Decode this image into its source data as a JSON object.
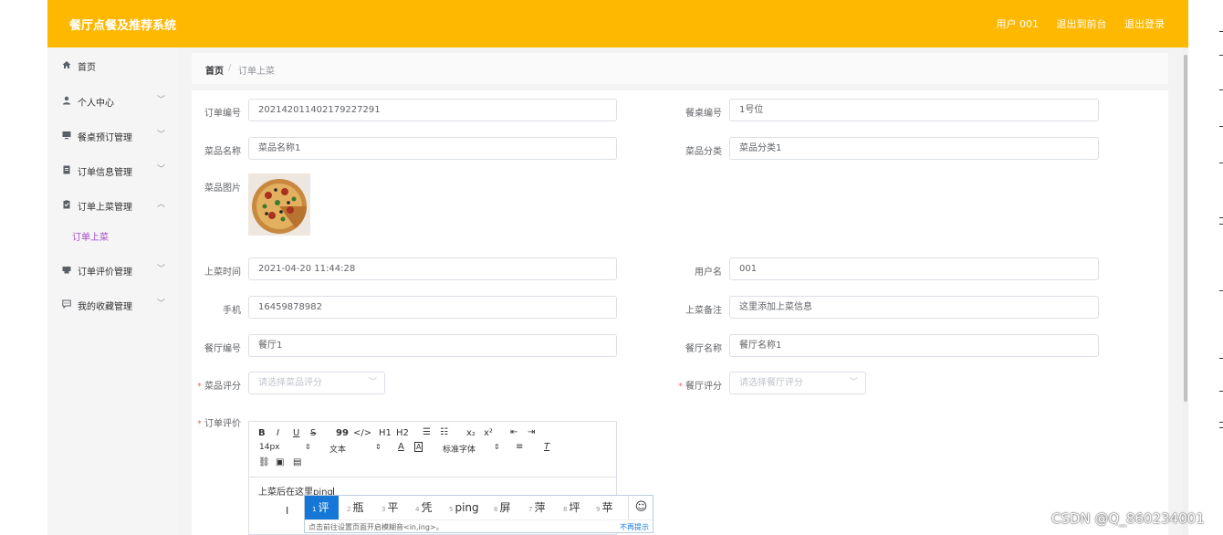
{
  "header": {
    "brand": "餐厅点餐及推荐系统",
    "user": "用户 001",
    "to_front": "退出到前台",
    "logout": "退出登录"
  },
  "sidebar": {
    "items": [
      {
        "label": "首页",
        "icon": "home-icon"
      },
      {
        "label": "个人中心",
        "icon": "user-icon"
      },
      {
        "label": "餐桌预订管理",
        "icon": "monitor-icon"
      },
      {
        "label": "订单信息管理",
        "icon": "document-icon"
      },
      {
        "label": "订单上菜管理",
        "icon": "clipboard-icon"
      },
      {
        "label": "订单评价管理",
        "icon": "printer-icon"
      },
      {
        "label": "我的收藏管理",
        "icon": "chat-icon"
      }
    ],
    "submenu": "订单上菜"
  },
  "breadcrumb": {
    "home": "首页",
    "separator": "/",
    "current": "订单上菜"
  },
  "form": {
    "order_no": {
      "label": "订单编号",
      "value": "202142011402179227291"
    },
    "table_no": {
      "label": "餐桌编号",
      "value": "1号位"
    },
    "dish_name": {
      "label": "菜品名称",
      "value": "菜品名称1"
    },
    "dish_category": {
      "label": "菜品分类",
      "value": "菜品分类1"
    },
    "dish_image": {
      "label": "菜品图片"
    },
    "serve_time": {
      "label": "上菜时间",
      "value": "2021-04-20 11:44:28"
    },
    "username": {
      "label": "用户名",
      "value": "001"
    },
    "phone": {
      "label": "手机",
      "value": "16459878982"
    },
    "serve_note": {
      "label": "上菜备注",
      "value": "这里添加上菜信息"
    },
    "restaurant_no": {
      "label": "餐厅编号",
      "value": "餐厅1"
    },
    "restaurant_name": {
      "label": "餐厅名称",
      "value": "餐厅名称1"
    },
    "dish_rating": {
      "label": "菜品评分",
      "placeholder": "请选择菜品评分"
    },
    "restaurant_rating": {
      "label": "餐厅评分",
      "placeholder": "请选择餐厅评分"
    },
    "order_review": {
      "label": "订单评价"
    },
    "required_mark": "*"
  },
  "editor": {
    "toolbar": {
      "bold": "B",
      "italic": "I",
      "underline": "U",
      "strike": "S",
      "quote": "99",
      "code": "</>",
      "h1": "H1",
      "h2": "H2",
      "sub": "x₂",
      "sup": "x²",
      "size": "14px",
      "paragraph": "文本",
      "font": "标准字体"
    },
    "content": "上菜后在这里ping"
  },
  "ime": {
    "candidates": [
      {
        "num": "1",
        "text": "评"
      },
      {
        "num": "2",
        "text": "瓶"
      },
      {
        "num": "3",
        "text": "平"
      },
      {
        "num": "4",
        "text": "凭"
      },
      {
        "num": "5",
        "text": "ping"
      },
      {
        "num": "6",
        "text": "屏"
      },
      {
        "num": "7",
        "text": "萍"
      },
      {
        "num": "8",
        "text": "坪"
      },
      {
        "num": "9",
        "text": "苹"
      }
    ],
    "hint": "点击前往设置页面开启模糊音<in,ing>。",
    "dismiss": "不再提示"
  },
  "watermark": "CSDN @Q_860234001",
  "colors": {
    "header": "#ffb800",
    "sidebar": "#f5f5f5",
    "submenu_active": "#a64ac9",
    "required": "#f56c6c",
    "ime_active": "#1677d6"
  }
}
